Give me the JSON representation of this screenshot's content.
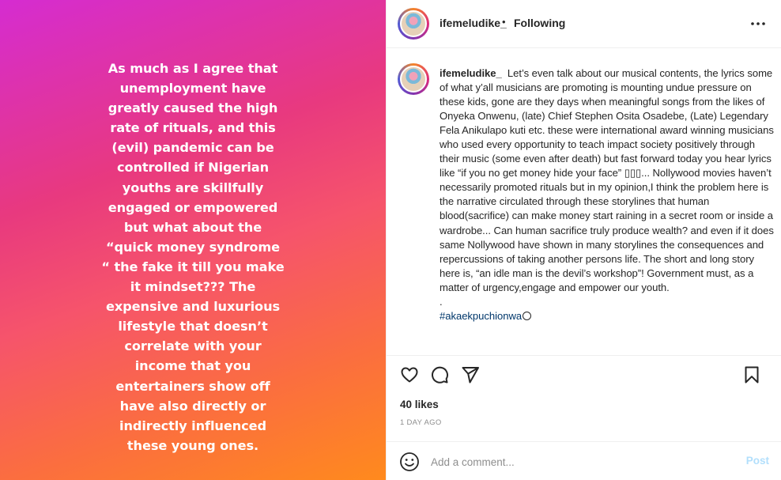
{
  "media": {
    "text": "As much as I agree that unemployment have greatly caused the high rate of rituals, and this (evil) pandemic can be controlled if Nigerian youths are skillfully engaged or empowered but what about the “quick money syndrome “ the fake it till you make it mindset??? The expensive and luxurious lifestyle that doesn’t correlate with your income that you entertainers show off have also directly or indirectly influenced these young ones."
  },
  "header": {
    "username": "ifemeludike_",
    "separator": "•",
    "follow_status": "Following",
    "more_icon": "more-horizontal-icon"
  },
  "caption": {
    "username": "ifemeludike_",
    "body": "Let’s even talk about our musical contents, the lyrics some of what y’all musicians are promoting is mounting undue pressure on these kids, gone are they days when meaningful songs from the likes of Onyeka Onwenu, (late) Chief Stephen Osita Osadebe, (Late) Legendary Fela Anikulapo kuti etc. these were international award winning musicians who used every opportunity to teach impact society positively through their music (some even after death) but fast forward today you hear lyrics like “if you no get money hide your face” ▯▯▯... Nollywood movies haven’t necessarily promoted rituals but in my opinion,I think the problem here is the narrative circulated through these storylines that human blood(sacrifice) can make money start raining in a secret room or inside a wardrobe... Can human sacrifice truly produce wealth? and even if it does same Nollywood have shown in many storylines the consequences and repercussions of taking another persons life. The short and long story here is, “an idle man is the devil’s workshop”! Government must, as a matter of urgency,engage and empower our youth.",
    "dot": ".",
    "hashtag": "#akaekpuchionwa"
  },
  "actions": {
    "like_icon": "heart-icon",
    "comment_icon": "comment-icon",
    "share_icon": "send-icon",
    "save_icon": "bookmark-icon",
    "likes": "40 likes",
    "time": "1 DAY AGO"
  },
  "comment": {
    "emoji_icon": "smiley-icon",
    "placeholder": "Add a comment...",
    "post_label": "Post"
  },
  "colors": {
    "gradient_start": "#d52cd1",
    "gradient_end": "#ff8a1d",
    "hashtag": "#00376b",
    "post_disabled": "#b2dffc",
    "muted": "#8e8e8e"
  }
}
